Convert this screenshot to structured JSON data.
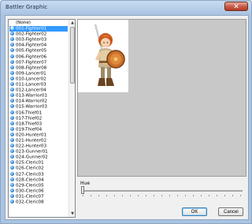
{
  "window": {
    "title": "Battler Graphic",
    "close_glyph": "✕"
  },
  "list": {
    "items": [
      {
        "label": "(None)",
        "type": "none"
      },
      {
        "label": "001-Fighter01",
        "selected": true
      },
      {
        "label": "002-Fighter02"
      },
      {
        "label": "003-Fighter03"
      },
      {
        "label": "004-Fighter04"
      },
      {
        "label": "005-Fighter05"
      },
      {
        "label": "006-Fighter06"
      },
      {
        "label": "007-Fighter07"
      },
      {
        "label": "008-Fighter08"
      },
      {
        "label": "009-Lancer01"
      },
      {
        "label": "010-Lancer02"
      },
      {
        "label": "011-Lancer03"
      },
      {
        "label": "012-Lancer04"
      },
      {
        "label": "013-Warrior01"
      },
      {
        "label": "014-Warrior02"
      },
      {
        "label": "015-Warrior03"
      },
      {
        "label": "016-Thief01"
      },
      {
        "label": "017-Thief02"
      },
      {
        "label": "018-Thief03"
      },
      {
        "label": "019-Thief04"
      },
      {
        "label": "020-Hunter01"
      },
      {
        "label": "021-Hunter02"
      },
      {
        "label": "022-Hunter03"
      },
      {
        "label": "023-Gunner01"
      },
      {
        "label": "024-Gunner02"
      },
      {
        "label": "025-Cleric01"
      },
      {
        "label": "026-Cleric02"
      },
      {
        "label": "027-Cleric03"
      },
      {
        "label": "028-Cleric04"
      },
      {
        "label": "029-Cleric05"
      },
      {
        "label": "030-Cleric06"
      },
      {
        "label": "031-Cleric07"
      },
      {
        "label": "032-Cleric08"
      }
    ],
    "scroll_up": "▲",
    "scroll_down": "▼"
  },
  "preview": {
    "sprite_icon": "fighter-sprite-icon"
  },
  "hue": {
    "label": "Hue",
    "value": 0
  },
  "buttons": {
    "ok": "OK",
    "cancel": "Cancel"
  },
  "colors": {
    "selection": "#3399ff",
    "preview_bg": "#c8c8c8"
  }
}
